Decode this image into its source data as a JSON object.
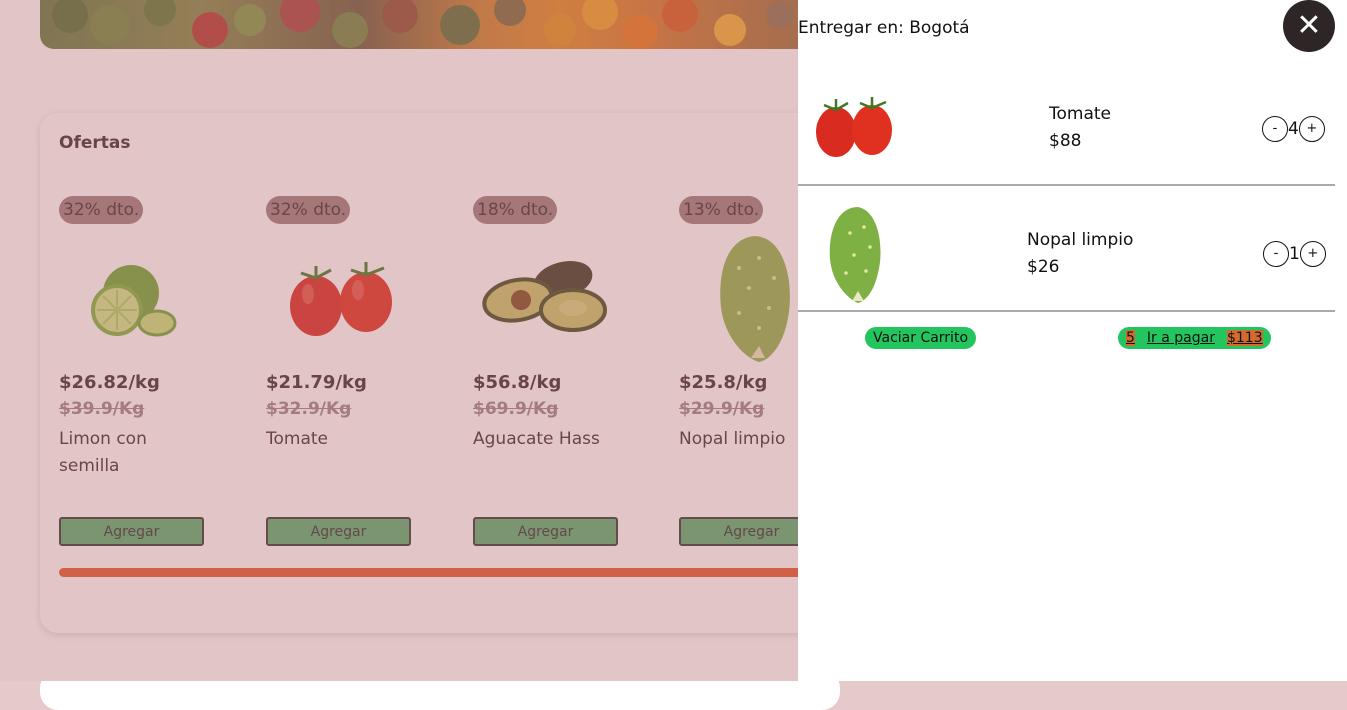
{
  "header": {
    "deliver_label": "Entregar en: Bogotá"
  },
  "offers": {
    "title": "Ofertas",
    "products": [
      {
        "discount": "32% dto.",
        "price": "$26.82/kg",
        "old_price": "$39.9/Kg",
        "name": "Limon con semilla",
        "button": "Agregar",
        "image": "lime-image"
      },
      {
        "discount": "32% dto.",
        "price": "$21.79/kg",
        "old_price": "$32.9/Kg",
        "name": "Tomate",
        "button": "Agregar",
        "image": "tomato-image"
      },
      {
        "discount": "18% dto.",
        "price": "$56.8/kg",
        "old_price": "$69.9/Kg",
        "name": "Aguacate Hass",
        "button": "Agregar",
        "image": "avocado-image"
      },
      {
        "discount": "13% dto.",
        "price": "$25.8/kg",
        "old_price": "$29.9/Kg",
        "name": "Nopal limpio",
        "button": "Agregar",
        "image": "nopal-image"
      }
    ]
  },
  "cart": {
    "close_icon": "close-icon",
    "items": [
      {
        "name": "Tomate",
        "price": "$88",
        "qty": "4",
        "minus": "-",
        "plus": "+"
      },
      {
        "name": "Nopal limpio",
        "price": "$26",
        "qty": "1",
        "minus": "-",
        "plus": "+"
      }
    ],
    "empty_label": "Vaciar Carrito",
    "checkout": {
      "count": "5",
      "label": "Ir a pagar",
      "total": "$113"
    }
  },
  "colors": {
    "accent_green": "#22c55e",
    "scroll_orange": "#e4572e",
    "overlay": "#b46e73"
  }
}
